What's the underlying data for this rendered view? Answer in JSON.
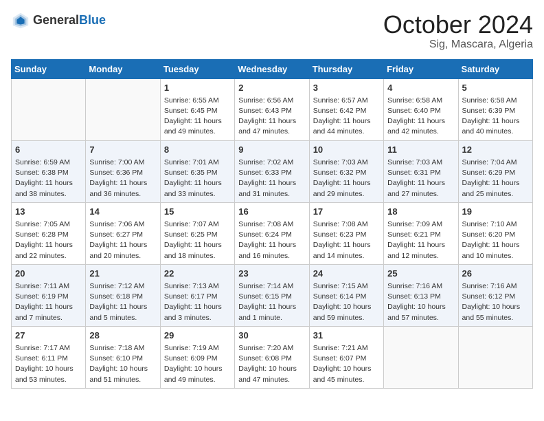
{
  "logo": {
    "general": "General",
    "blue": "Blue"
  },
  "title": "October 2024",
  "subtitle": "Sig, Mascara, Algeria",
  "weekdays": [
    "Sunday",
    "Monday",
    "Tuesday",
    "Wednesday",
    "Thursday",
    "Friday",
    "Saturday"
  ],
  "weeks": [
    [
      {
        "day": null
      },
      {
        "day": null
      },
      {
        "day": "1",
        "sunrise": "Sunrise: 6:55 AM",
        "sunset": "Sunset: 6:45 PM",
        "daylight": "Daylight: 11 hours and 49 minutes."
      },
      {
        "day": "2",
        "sunrise": "Sunrise: 6:56 AM",
        "sunset": "Sunset: 6:43 PM",
        "daylight": "Daylight: 11 hours and 47 minutes."
      },
      {
        "day": "3",
        "sunrise": "Sunrise: 6:57 AM",
        "sunset": "Sunset: 6:42 PM",
        "daylight": "Daylight: 11 hours and 44 minutes."
      },
      {
        "day": "4",
        "sunrise": "Sunrise: 6:58 AM",
        "sunset": "Sunset: 6:40 PM",
        "daylight": "Daylight: 11 hours and 42 minutes."
      },
      {
        "day": "5",
        "sunrise": "Sunrise: 6:58 AM",
        "sunset": "Sunset: 6:39 PM",
        "daylight": "Daylight: 11 hours and 40 minutes."
      }
    ],
    [
      {
        "day": "6",
        "sunrise": "Sunrise: 6:59 AM",
        "sunset": "Sunset: 6:38 PM",
        "daylight": "Daylight: 11 hours and 38 minutes."
      },
      {
        "day": "7",
        "sunrise": "Sunrise: 7:00 AM",
        "sunset": "Sunset: 6:36 PM",
        "daylight": "Daylight: 11 hours and 36 minutes."
      },
      {
        "day": "8",
        "sunrise": "Sunrise: 7:01 AM",
        "sunset": "Sunset: 6:35 PM",
        "daylight": "Daylight: 11 hours and 33 minutes."
      },
      {
        "day": "9",
        "sunrise": "Sunrise: 7:02 AM",
        "sunset": "Sunset: 6:33 PM",
        "daylight": "Daylight: 11 hours and 31 minutes."
      },
      {
        "day": "10",
        "sunrise": "Sunrise: 7:03 AM",
        "sunset": "Sunset: 6:32 PM",
        "daylight": "Daylight: 11 hours and 29 minutes."
      },
      {
        "day": "11",
        "sunrise": "Sunrise: 7:03 AM",
        "sunset": "Sunset: 6:31 PM",
        "daylight": "Daylight: 11 hours and 27 minutes."
      },
      {
        "day": "12",
        "sunrise": "Sunrise: 7:04 AM",
        "sunset": "Sunset: 6:29 PM",
        "daylight": "Daylight: 11 hours and 25 minutes."
      }
    ],
    [
      {
        "day": "13",
        "sunrise": "Sunrise: 7:05 AM",
        "sunset": "Sunset: 6:28 PM",
        "daylight": "Daylight: 11 hours and 22 minutes."
      },
      {
        "day": "14",
        "sunrise": "Sunrise: 7:06 AM",
        "sunset": "Sunset: 6:27 PM",
        "daylight": "Daylight: 11 hours and 20 minutes."
      },
      {
        "day": "15",
        "sunrise": "Sunrise: 7:07 AM",
        "sunset": "Sunset: 6:25 PM",
        "daylight": "Daylight: 11 hours and 18 minutes."
      },
      {
        "day": "16",
        "sunrise": "Sunrise: 7:08 AM",
        "sunset": "Sunset: 6:24 PM",
        "daylight": "Daylight: 11 hours and 16 minutes."
      },
      {
        "day": "17",
        "sunrise": "Sunrise: 7:08 AM",
        "sunset": "Sunset: 6:23 PM",
        "daylight": "Daylight: 11 hours and 14 minutes."
      },
      {
        "day": "18",
        "sunrise": "Sunrise: 7:09 AM",
        "sunset": "Sunset: 6:21 PM",
        "daylight": "Daylight: 11 hours and 12 minutes."
      },
      {
        "day": "19",
        "sunrise": "Sunrise: 7:10 AM",
        "sunset": "Sunset: 6:20 PM",
        "daylight": "Daylight: 11 hours and 10 minutes."
      }
    ],
    [
      {
        "day": "20",
        "sunrise": "Sunrise: 7:11 AM",
        "sunset": "Sunset: 6:19 PM",
        "daylight": "Daylight: 11 hours and 7 minutes."
      },
      {
        "day": "21",
        "sunrise": "Sunrise: 7:12 AM",
        "sunset": "Sunset: 6:18 PM",
        "daylight": "Daylight: 11 hours and 5 minutes."
      },
      {
        "day": "22",
        "sunrise": "Sunrise: 7:13 AM",
        "sunset": "Sunset: 6:17 PM",
        "daylight": "Daylight: 11 hours and 3 minutes."
      },
      {
        "day": "23",
        "sunrise": "Sunrise: 7:14 AM",
        "sunset": "Sunset: 6:15 PM",
        "daylight": "Daylight: 11 hours and 1 minute."
      },
      {
        "day": "24",
        "sunrise": "Sunrise: 7:15 AM",
        "sunset": "Sunset: 6:14 PM",
        "daylight": "Daylight: 10 hours and 59 minutes."
      },
      {
        "day": "25",
        "sunrise": "Sunrise: 7:16 AM",
        "sunset": "Sunset: 6:13 PM",
        "daylight": "Daylight: 10 hours and 57 minutes."
      },
      {
        "day": "26",
        "sunrise": "Sunrise: 7:16 AM",
        "sunset": "Sunset: 6:12 PM",
        "daylight": "Daylight: 10 hours and 55 minutes."
      }
    ],
    [
      {
        "day": "27",
        "sunrise": "Sunrise: 7:17 AM",
        "sunset": "Sunset: 6:11 PM",
        "daylight": "Daylight: 10 hours and 53 minutes."
      },
      {
        "day": "28",
        "sunrise": "Sunrise: 7:18 AM",
        "sunset": "Sunset: 6:10 PM",
        "daylight": "Daylight: 10 hours and 51 minutes."
      },
      {
        "day": "29",
        "sunrise": "Sunrise: 7:19 AM",
        "sunset": "Sunset: 6:09 PM",
        "daylight": "Daylight: 10 hours and 49 minutes."
      },
      {
        "day": "30",
        "sunrise": "Sunrise: 7:20 AM",
        "sunset": "Sunset: 6:08 PM",
        "daylight": "Daylight: 10 hours and 47 minutes."
      },
      {
        "day": "31",
        "sunrise": "Sunrise: 7:21 AM",
        "sunset": "Sunset: 6:07 PM",
        "daylight": "Daylight: 10 hours and 45 minutes."
      },
      {
        "day": null
      },
      {
        "day": null
      }
    ]
  ]
}
